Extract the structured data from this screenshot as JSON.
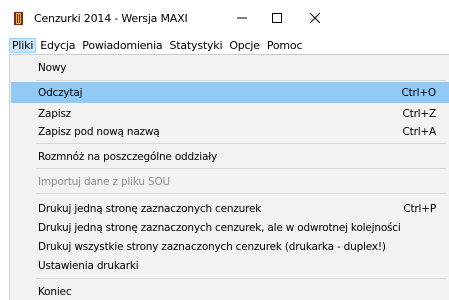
{
  "window": {
    "title": "Cenzurki 2014 - Wersja MAXI",
    "icon": "app-book-icon",
    "controls": [
      "minimize-icon",
      "maximize-icon",
      "close-icon"
    ]
  },
  "menubar": {
    "items": [
      {
        "label": "Pliki",
        "active": true
      },
      {
        "label": "Edycja"
      },
      {
        "label": "Powiadomienia"
      },
      {
        "label": "Statystyki"
      },
      {
        "label": "Opcje"
      },
      {
        "label": "Pomoc"
      }
    ]
  },
  "file_menu": {
    "items": [
      {
        "label": "Nowy",
        "shortcut": ""
      },
      {
        "label": "Odczytaj",
        "shortcut": "Ctrl+O",
        "highlighted": true
      },
      {
        "label": "Zapisz",
        "shortcut": "Ctrl+Z"
      },
      {
        "label": "Zapisz pod nową nazwą",
        "shortcut": "Ctrl+A"
      },
      {
        "label": "Rozmnóż na poszczególne oddziały",
        "shortcut": ""
      },
      {
        "label": "Importuj dane z pliku SOU",
        "shortcut": "",
        "disabled": true
      },
      {
        "label": "Drukuj jedną stronę zaznaczonych cenzurek",
        "shortcut": "Ctrl+P"
      },
      {
        "label": "Drukuj jedną stronę zaznaczonych cenzurek, ale w odwrotnej kolejności",
        "shortcut": ""
      },
      {
        "label": "Drukuj wszystkie strony zaznaczonych cenzurek (drukarka - duplex!)",
        "shortcut": ""
      },
      {
        "label": "Ustawienia drukarki",
        "shortcut": ""
      },
      {
        "label": "Koniec",
        "shortcut": ""
      }
    ]
  },
  "colors": {
    "highlight": "#91c9f7",
    "menu_background": "#f2f2f2",
    "disabled_text": "#8d8d8d",
    "active_menubar": "#cce8ff"
  }
}
